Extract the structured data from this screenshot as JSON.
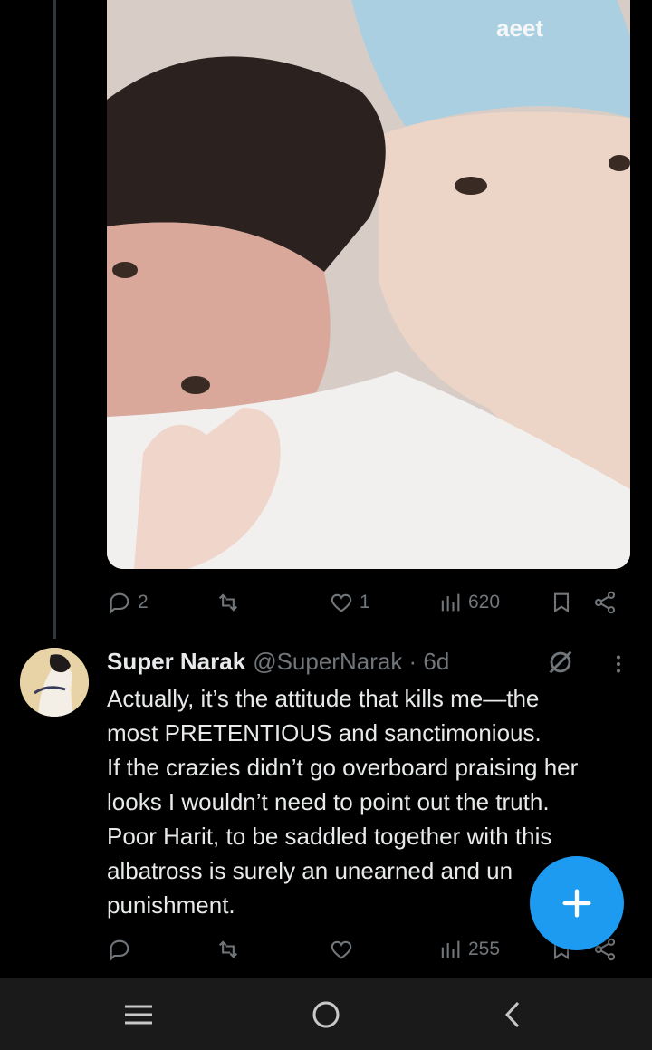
{
  "prev_post_actions": {
    "replies": "2",
    "reposts": "",
    "likes": "1",
    "views": "620"
  },
  "post": {
    "author_name": "Super Narak",
    "handle_time": "@SuperNarak · 6d",
    "lines": [
      "Actually, it’s the attitude that kills me—the",
      "most PRETENTIOUS and sanctimonious.",
      "If the crazies didn’t go overboard praising her",
      "looks I wouldn’t need to point out the truth.",
      "Poor Harit, to be saddled together with this",
      "albatross is surely an unearned and un",
      "punishment."
    ],
    "actions": {
      "replies": "",
      "reposts": "",
      "likes": "",
      "views": "255"
    }
  },
  "media": {
    "cap_text": "aeet"
  },
  "icons": {
    "reply": "speech-bubble-icon",
    "repost": "repost-icon",
    "like": "heart-icon",
    "views": "bar-chart-icon",
    "bookmark": "bookmark-icon",
    "share": "share-icon",
    "grok": "grok-icon",
    "more": "more-vertical-icon",
    "compose": "plus-icon"
  },
  "colors": {
    "background": "#000000",
    "text": "#e7e9ea",
    "muted": "#71767b",
    "accent": "#1d9bf0"
  }
}
